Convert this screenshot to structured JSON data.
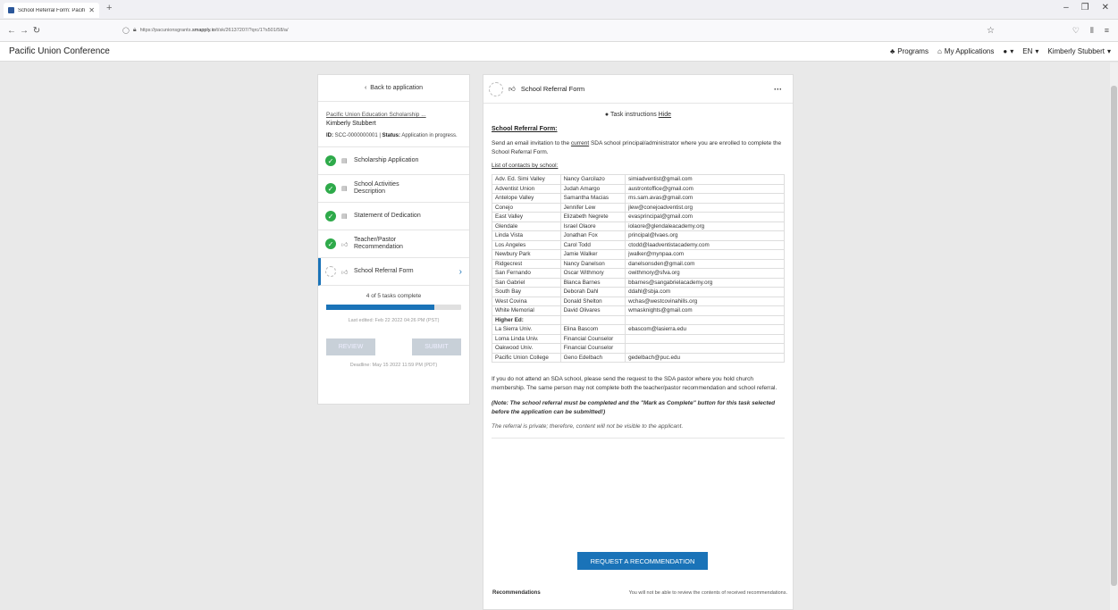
{
  "browser": {
    "tab_title": "School Referral Form: Pacific U...",
    "url_prefix": "https://pacunionsgrants.",
    "url_host": "smapply.io",
    "url_path": "/t/sk/26137207/?qrc/1?s501/58/a/"
  },
  "header": {
    "brand": "Pacific Union Conference",
    "programs": "Programs",
    "my_applications": "My Applications",
    "language": "EN",
    "user": "Kimberly Stubbert"
  },
  "sidebar": {
    "back": "Back to application",
    "program_link": "Pacific Union Education Scholarship ...",
    "user": "Kimberly Stubbert",
    "id_label": "ID:",
    "id_value": "SCC-0000000001",
    "status_label": "Status:",
    "status_value": "Application in progress.",
    "tasks": [
      {
        "label": "Scholarship Application",
        "done": true
      },
      {
        "label": "School Activities Description",
        "done": true
      },
      {
        "label": "Statement of Dedication",
        "done": true
      },
      {
        "label": "Teacher/Pastor Recommendation",
        "done": true
      },
      {
        "label": "School Referral Form",
        "done": false
      }
    ],
    "progress_text": "4 of 5 tasks complete",
    "progress_fraction": 0.8,
    "last_edited": "Last edited: Feb 22 2022 04:26 PM (PST)",
    "review": "REVIEW",
    "submit": "SUBMIT",
    "deadline": "Deadline: May 15 2022 11:59 PM (PDT)"
  },
  "main": {
    "title": "School Referral Form",
    "instructions_text": "Task instructions",
    "instructions_hide": "Hide",
    "section_title": "School Referral Form:",
    "para1_a": "Send an email invitation to the",
    "para1_current": "current",
    "para1_b": "SDA school principal/administrator where you are enrolled to complete the School Referral Form.",
    "list_title": "List of contacts by school:",
    "contacts": [
      [
        "Adv. Ed. Simi Valley",
        "Nancy Garcilazo",
        "simiadventist@gmail.com"
      ],
      [
        "Adventist Union",
        "Judah Amargo",
        "austrontoffice@gmail.com"
      ],
      [
        "Antelope Valley",
        "Samantha Macias",
        "ms.sam.avas@gmail.com"
      ],
      [
        "Conejo",
        "Jennifer Lew",
        "jlew@conejoadventist.org"
      ],
      [
        "East Valley",
        "Elizabeth Negrete",
        "evasprincipal@gmail.com"
      ],
      [
        "Glendale",
        "Israel Olaore",
        "iolaore@glendaleacademy.org"
      ],
      [
        "Linda Vista",
        "Jonathan Fox",
        "principal@lvaes.org"
      ],
      [
        "Los Angeles",
        "Carol Todd",
        "ctodd@laadventistacademy.com"
      ],
      [
        "Newbury Park",
        "Jamie Walker",
        "jwalker@mynpaa.com"
      ],
      [
        "Ridgecrest",
        "Nancy Danelson",
        "danelsonsden@gmail.com"
      ],
      [
        "San Fernando",
        "Oscar Withmory",
        "owithmory@sfva.org"
      ],
      [
        "San Gabriel",
        "Blanca Barnes",
        "bbarnes@sangabrielacademy.org"
      ],
      [
        "South Bay",
        "Deborah Dahl",
        "ddahl@sbja.com"
      ],
      [
        "West Covina",
        "Donald Shelton",
        "wchas@westcovinahills.org"
      ],
      [
        "White Memorial",
        "David Olivares",
        "wmasknights@gmail.com"
      ],
      [
        "Higher Ed:",
        "",
        ""
      ],
      [
        "La Sierra Univ.",
        "Elina Bascom",
        "ebascom@lasierra.edu"
      ],
      [
        "Loma Linda Univ.",
        "Financial Counselor",
        ""
      ],
      [
        "Oakwood Univ.",
        "Financial Counselor",
        ""
      ],
      [
        "Pacific Union College",
        "Geno Edelbach",
        "gedelbach@puc.edu"
      ]
    ],
    "para2": "If you do not attend an SDA school, please send the request to the SDA pastor where you hold church membership. The same person may not complete both the teacher/pastor recommendation and school referral.",
    "note": "(Note: The school referral must be completed and the \"Mark as Complete\" button for this task selected before the application can be submitted!)",
    "private": "The referral is private; therefore, content will not be visible to the applicant.",
    "request_button": "REQUEST A RECOMMENDATION",
    "recs_label": "Recommendations",
    "recs_note": "You will not be able to review the contents of received recommendations."
  },
  "colors": {
    "accent": "#1a73b8",
    "done": "#2eaa4a",
    "disabled_button": "#c8d0d8"
  }
}
